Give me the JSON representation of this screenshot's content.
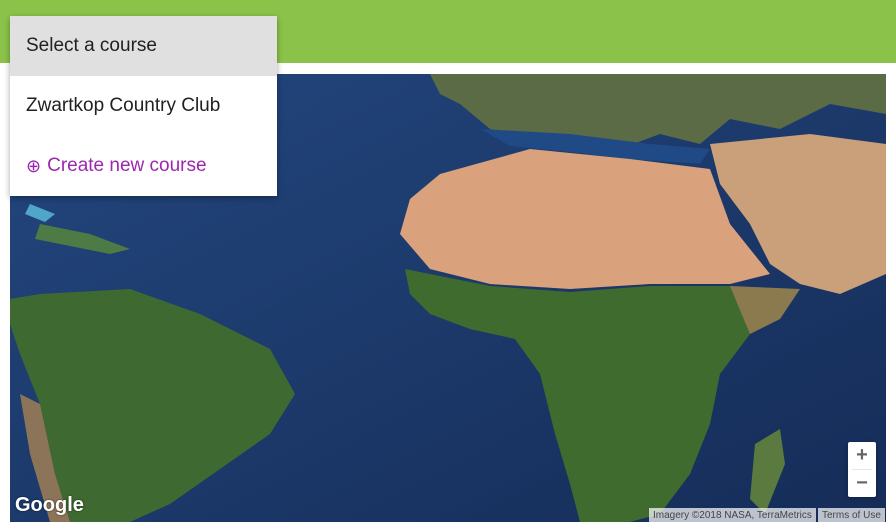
{
  "course_selector": {
    "selected_label": "Select a course",
    "items": [
      {
        "label": "Zwartkop Country Club"
      }
    ],
    "create_label": "Create new course",
    "create_icon": "add-circle-icon"
  },
  "map": {
    "zoom_in_label": "+",
    "zoom_out_label": "−",
    "logo_text": "Google",
    "imagery_credit": "Imagery ©2018 NASA, TerraMetrics",
    "terms_label": "Terms of Use"
  },
  "colors": {
    "appbar": "#8bc34a",
    "accent": "#9c27b0",
    "ocean": "#1b3a6b"
  }
}
